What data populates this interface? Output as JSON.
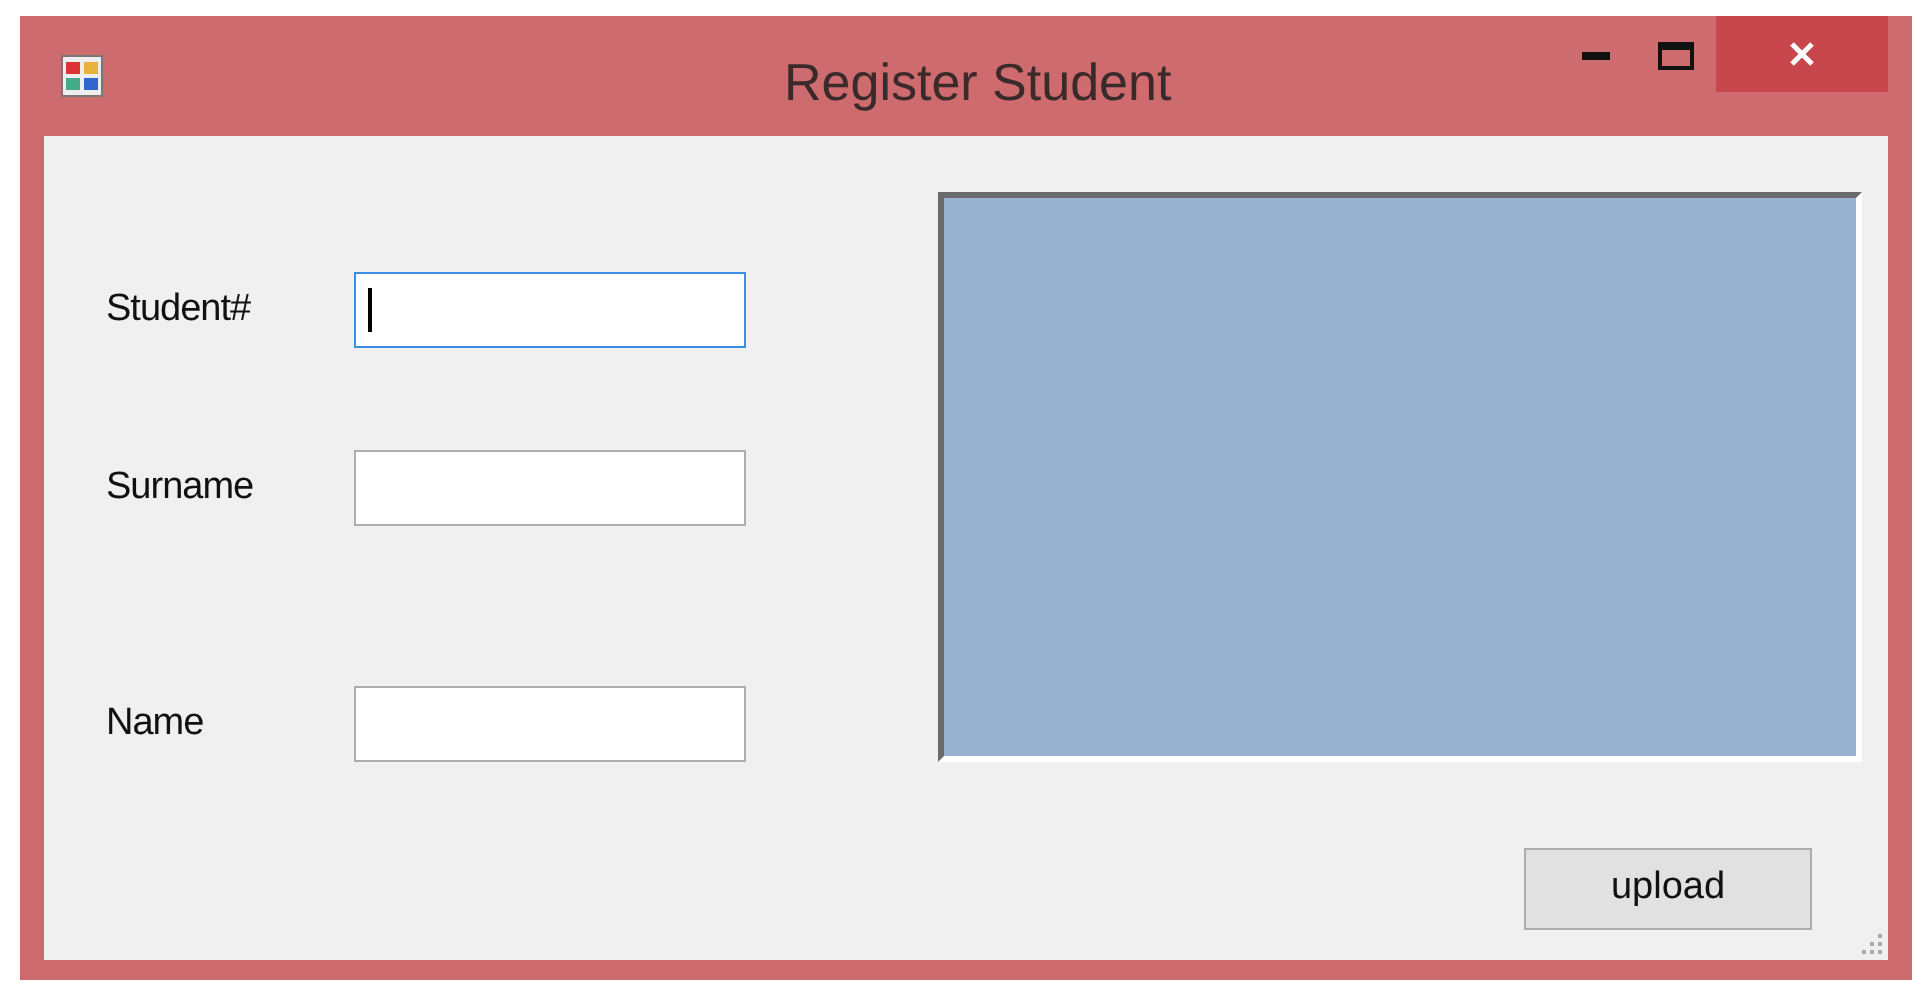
{
  "window": {
    "title": "Register Student"
  },
  "fields": [
    {
      "label": "Student#",
      "focused": true
    },
    {
      "label": "Surname",
      "focused": false
    },
    {
      "label": "Name",
      "focused": false
    }
  ],
  "buttons": [
    {
      "label": "upload"
    }
  ]
}
